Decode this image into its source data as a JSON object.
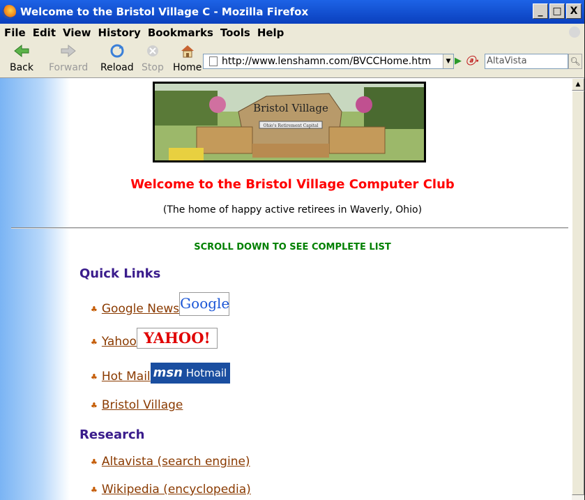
{
  "window": {
    "title": "Welcome to the Bristol Village C - Mozilla Firefox",
    "controls": [
      "_",
      "□",
      "X"
    ]
  },
  "menu": [
    "File",
    "Edit",
    "View",
    "History",
    "Bookmarks",
    "Tools",
    "Help"
  ],
  "nav": {
    "back": "Back",
    "forward": "Forward",
    "reload": "Reload",
    "stop": "Stop",
    "home": "Home",
    "url": "http://www.lenshamn.com/BVCCHome.htm",
    "search_engine_placeholder": "AltaVista"
  },
  "page": {
    "banner_sign": "Bristol Village",
    "banner_plaque": "Ohio's Retirement Capital",
    "welcome": "Welcome to the Bristol Village Computer Club",
    "subtitle": "(The home of happy active retirees in Waverly, Ohio)",
    "scroll_note": "SCROLL DOWN TO SEE COMPLETE LIST",
    "sections": [
      {
        "title": "Quick Links",
        "links": [
          {
            "text": "Google News",
            "logo": "Google"
          },
          {
            "text": "Yahoo",
            "logo": "YAHOO!"
          },
          {
            "text": "Hot Mail",
            "logo": "Hotmail"
          },
          {
            "text": "Bristol Village"
          }
        ]
      },
      {
        "title": "Research",
        "links": [
          {
            "text": " Altavista (search engine)"
          },
          {
            "text": "Wikipedia (encyclopedia)"
          }
        ]
      }
    ],
    "logo_text": {
      "google": "Google",
      "google_sub": "News",
      "yahoo": "YAHOO!",
      "msn": "msn",
      "hotmail": "Hotmail"
    }
  },
  "colors": {
    "titlebar": "#0a3fbd",
    "welcome": "#ff0000",
    "scroll_note": "#008000",
    "section_heading": "#3a1c8c",
    "link": "#8a3a00"
  }
}
